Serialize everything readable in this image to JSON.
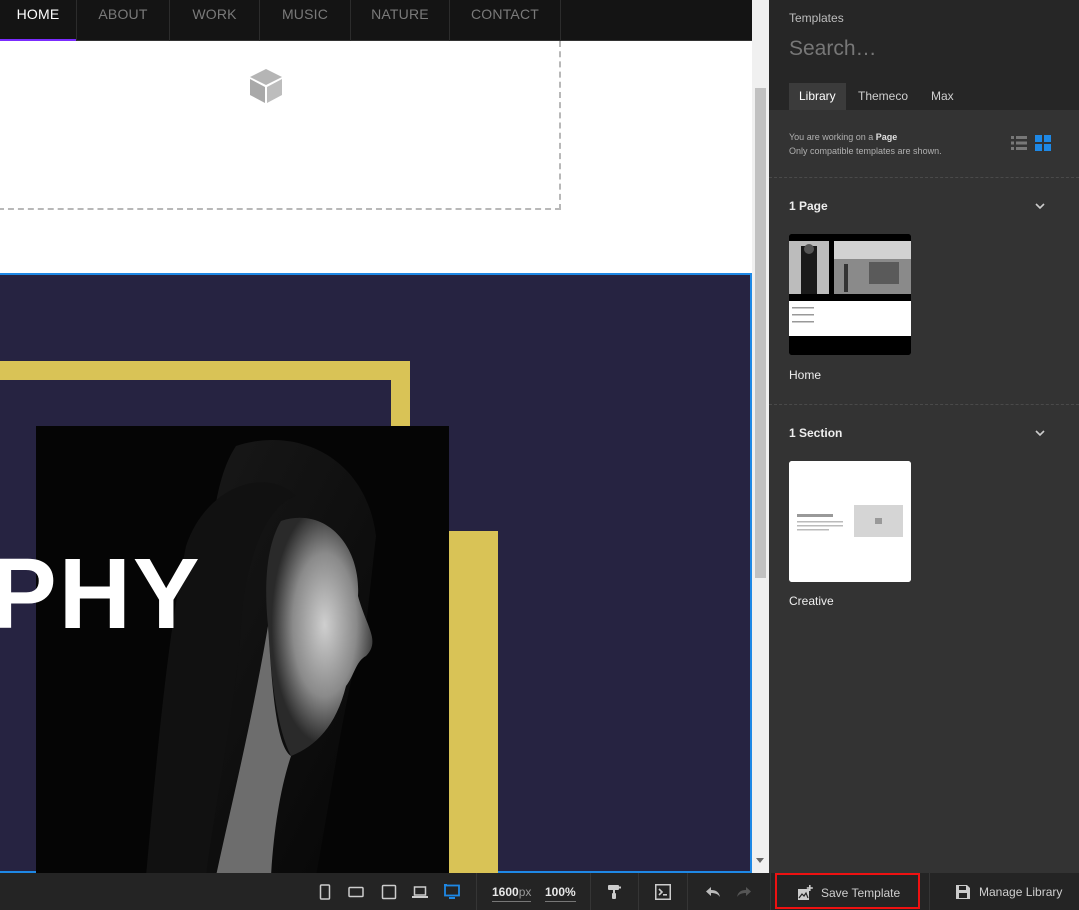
{
  "nav": {
    "items": [
      {
        "label": "HOME",
        "active": true
      },
      {
        "label": "ABOUT",
        "active": false
      },
      {
        "label": "WORK",
        "active": false
      },
      {
        "label": "MUSIC",
        "active": false
      },
      {
        "label": "NATURE",
        "active": false
      },
      {
        "label": "CONTACT",
        "active": false
      }
    ]
  },
  "hero": {
    "text": "PHY"
  },
  "panel": {
    "title": "Templates",
    "search_placeholder": "Search…",
    "tabs": [
      {
        "label": "Library",
        "active": true
      },
      {
        "label": "Themeco",
        "active": false
      },
      {
        "label": "Max",
        "active": false
      }
    ],
    "info_prefix": "You are working on a ",
    "info_bold": "Page",
    "info_line2": "Only compatible templates are shown.",
    "groups": [
      {
        "title": "1 Page",
        "items": [
          {
            "label": "Home"
          }
        ]
      },
      {
        "title": "1 Section",
        "items": [
          {
            "label": "Creative"
          }
        ]
      }
    ]
  },
  "bottombar": {
    "width_value": "1600",
    "width_unit": "px",
    "zoom": "100%",
    "save_template": "Save Template",
    "manage_library": "Manage Library"
  },
  "colors": {
    "accent_blue": "#1e88e5",
    "hero_bg": "#262341",
    "hero_yellow": "#d9c356",
    "nav_active": "#7b2cff",
    "highlight_red": "#e11111"
  }
}
